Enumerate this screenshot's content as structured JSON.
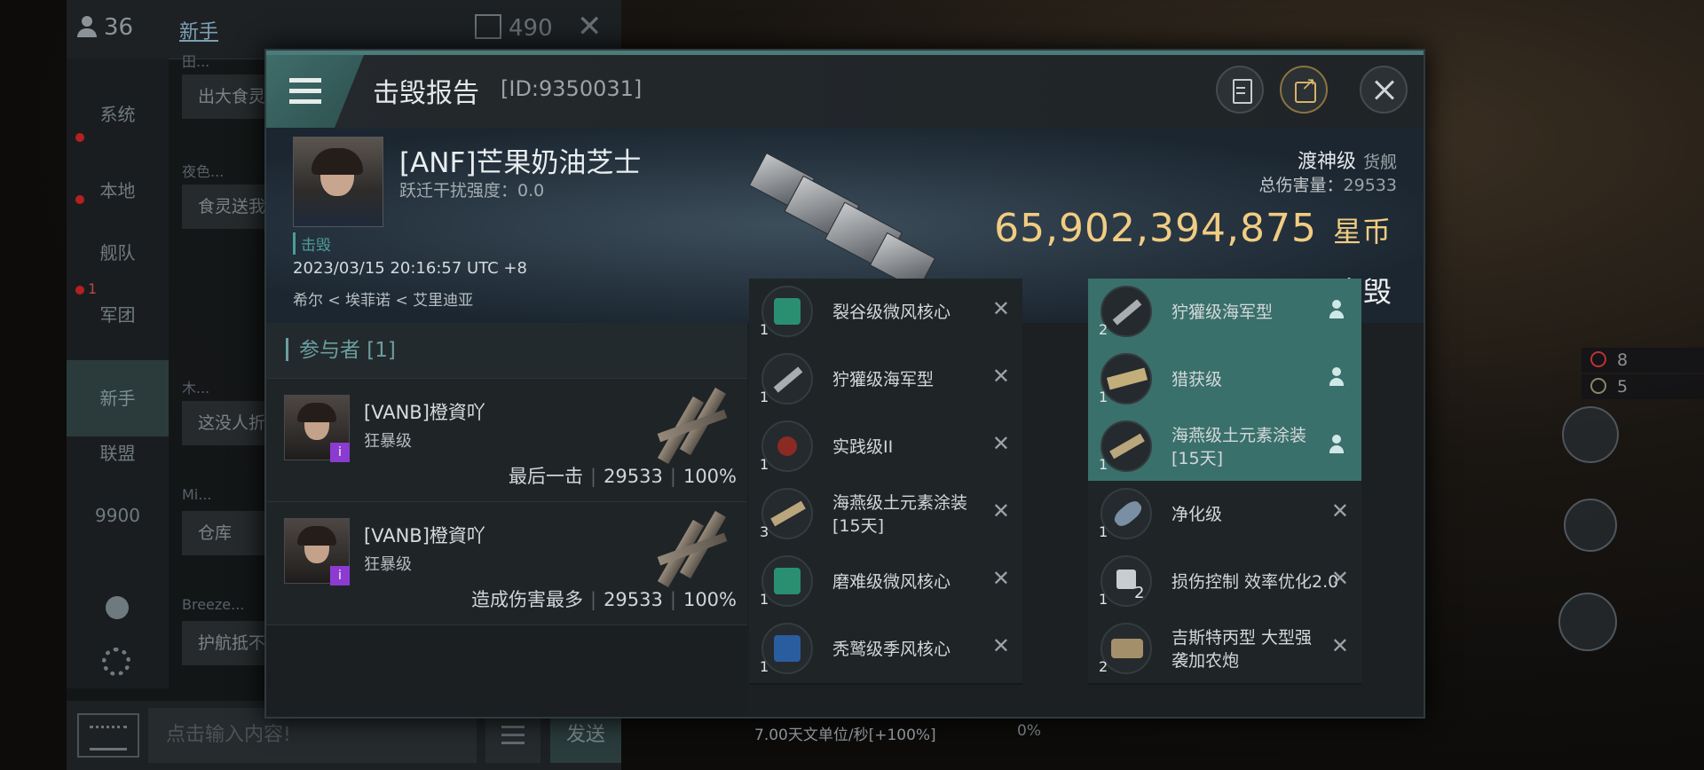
{
  "chat": {
    "online_count": "36",
    "tab_label": "新手",
    "box_count": "490",
    "sidebar": [
      "系统",
      "本地",
      "舰队",
      "军团",
      "新手",
      "联盟",
      "9900"
    ],
    "legion_badge": "1",
    "messages": [
      {
        "name": "田...",
        "text": "出大食灵"
      },
      {
        "name": "夜色...",
        "text": "食灵送我"
      },
      {
        "name": "木...",
        "text": "这没人折"
      },
      {
        "name": "Mi...",
        "text": "仓库"
      },
      {
        "name": "Breeze...",
        "text": "护航抵不"
      }
    ],
    "input_placeholder": "点击输入内容!",
    "send_label": "发送"
  },
  "hud": {
    "top_count": "8",
    "bottom_count": "5"
  },
  "report": {
    "title": "击毁报告",
    "report_id": "[ID:9350031]",
    "victim": {
      "name": "[ANF]芒果奶油芝士",
      "warp_scramble": "跃迁干扰强度：0.0",
      "kill_tag": "击毁",
      "datetime": "2023/03/15 20:16:57 UTC +8",
      "location": "希尔 < 埃菲诺 < 艾里迪亚",
      "ship_type": "渡神级",
      "ship_class": "货舰",
      "damage_label": "总伤害量：",
      "damage_value": "29533",
      "isk_value": "65,902,394,875",
      "isk_unit": "星币",
      "result": "击毁"
    },
    "participants_header": "参与者 [1]",
    "participants": [
      {
        "name": "[VANB]橙資吖",
        "ship": "狂暴级",
        "role": "最后一击",
        "damage": "29533",
        "percent": "100%"
      },
      {
        "name": "[VANB]橙資吖",
        "ship": "狂暴级",
        "role": "造成伤害最多",
        "damage": "29533",
        "percent": "100%"
      }
    ],
    "items_left": [
      {
        "qty": "1",
        "name": "裂谷级微风核心",
        "icon": "green-core-icon"
      },
      {
        "qty": "1",
        "name": "狞獾级海军型",
        "icon": "ship-icon"
      },
      {
        "qty": "1",
        "name": "实践级II",
        "icon": "drone-icon"
      },
      {
        "qty": "3",
        "name": "海燕级土元素涂装[15天]",
        "icon": "skin-icon"
      },
      {
        "qty": "1",
        "name": "磨难级微风核心",
        "icon": "green-core-icon"
      },
      {
        "qty": "1",
        "name": "秃鹫级季风核心",
        "icon": "blue-core-icon"
      }
    ],
    "items_right": [
      {
        "qty": "2",
        "name": "狞獾级海军型",
        "icon": "ship-icon",
        "highlight": true
      },
      {
        "qty": "1",
        "name": "猎获级",
        "icon": "ship-icon",
        "highlight": true
      },
      {
        "qty": "1",
        "name": "海燕级土元素涂装[15天]",
        "icon": "skin-icon",
        "highlight": true
      },
      {
        "qty": "1",
        "name": "净化级",
        "icon": "ship-icon",
        "highlight": false
      },
      {
        "qty": "1",
        "name": "损伤控制 效率优化2.0",
        "icon": "module-icon",
        "badge": "2",
        "highlight": false
      },
      {
        "qty": "2",
        "name": "吉斯特丙型 大型强袭加农炮",
        "icon": "turret-icon",
        "highlight": false
      }
    ],
    "footer_speed": "7.00天文单位/秒[+100%]",
    "footer_pct": "0%"
  }
}
